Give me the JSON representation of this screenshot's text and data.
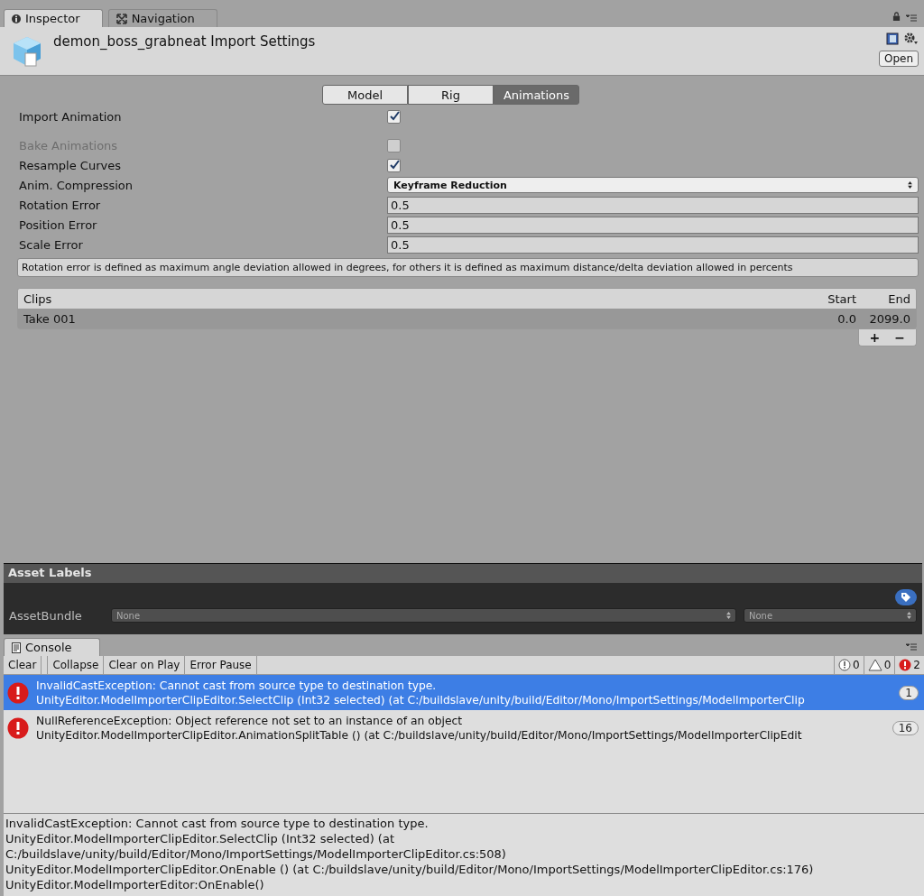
{
  "panel_tabs": [
    {
      "label": "Inspector",
      "selected": true
    },
    {
      "label": "Navigation",
      "selected": false
    }
  ],
  "header": {
    "title": "demon_boss_grabneat Import Settings",
    "open_button": "Open"
  },
  "mode_tabs": [
    {
      "label": "Model",
      "selected": false
    },
    {
      "label": "Rig",
      "selected": false
    },
    {
      "label": "Animations",
      "selected": true
    }
  ],
  "settings": [
    {
      "kind": "checkbox",
      "label": "Import Animation",
      "checked": true,
      "disabled": false
    },
    {
      "kind": "checkbox",
      "label": "Bake Animations",
      "checked": false,
      "disabled": true
    },
    {
      "kind": "checkbox",
      "label": "Resample Curves",
      "checked": true,
      "disabled": false
    },
    {
      "kind": "dropdown",
      "label": "Anim. Compression",
      "value": "Keyframe Reduction"
    },
    {
      "kind": "number",
      "label": "Rotation Error",
      "value": "0.5"
    },
    {
      "kind": "number",
      "label": "Position Error",
      "value": "0.5"
    },
    {
      "kind": "number",
      "label": "Scale Error",
      "value": "0.5"
    }
  ],
  "help_text": "Rotation error is defined as maximum angle deviation allowed in degrees, for others it is defined as maximum distance/delta deviation allowed in percents",
  "clips": {
    "columns": [
      "Clips",
      "Start",
      "End"
    ],
    "rows": [
      {
        "name": "Take 001",
        "start": "0.0",
        "end": "2099.0",
        "selected": true
      }
    ],
    "add_button": "+",
    "remove_button": "−"
  },
  "asset_labels": {
    "title": "Asset Labels",
    "bundle_label": "AssetBundle",
    "bundle": "None",
    "variant": "None"
  },
  "console": {
    "tab": "Console",
    "toolbar": [
      "Clear",
      "Collapse",
      "Clear on Play",
      "Error Pause"
    ],
    "counts": {
      "info": "0",
      "warning": "0",
      "error": "2"
    },
    "messages": [
      {
        "title": "InvalidCastException: Cannot cast from source type to destination type.",
        "trace": "UnityEditor.ModelImporterClipEditor.SelectClip (Int32 selected) (at C:/buildslave/unity/build/Editor/Mono/ImportSettings/ModelImporterClip",
        "count": "1",
        "selected": true
      },
      {
        "title": "NullReferenceException: Object reference not set to an instance of an object",
        "trace": "UnityEditor.ModelImporterClipEditor.AnimationSplitTable () (at C:/buildslave/unity/build/Editor/Mono/ImportSettings/ModelImporterClipEdit",
        "count": "16",
        "selected": false
      }
    ],
    "detail": [
      "InvalidCastException: Cannot cast from source type to destination type.",
      "UnityEditor.ModelImporterClipEditor.SelectClip (Int32 selected) (at",
      "C:/buildslave/unity/build/Editor/Mono/ImportSettings/ModelImporterClipEditor.cs:508)",
      "UnityEditor.ModelImporterClipEditor.OnEnable () (at C:/buildslave/unity/build/Editor/Mono/ImportSettings/ModelImporterClipEditor.cs:176)",
      "UnityEditor.ModelImporterEditor:OnEnable()"
    ]
  }
}
